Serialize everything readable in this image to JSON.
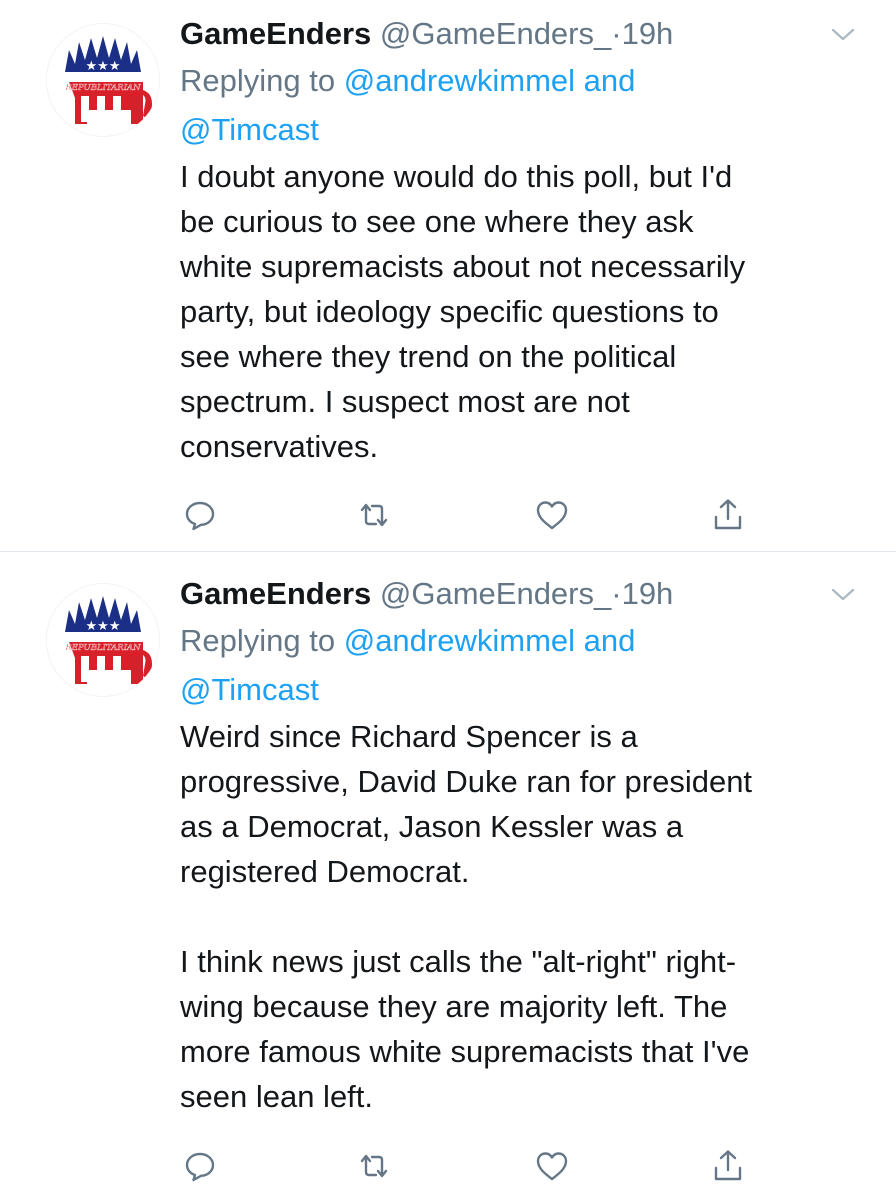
{
  "tweets": [
    {
      "display_name": "GameEnders",
      "handle": "@GameEnders_",
      "separator": "·",
      "time": "19h",
      "reply_prefix": "Replying to",
      "reply_user1": "@andrewkimmel",
      "reply_and": "and",
      "reply_user2": "@Timcast",
      "avatar_text": "REPUBLITARIAN",
      "body": "I doubt anyone would do this poll, but I'd\nbe curious to see one where they ask\nwhite supremacists about not necessarily\nparty, but ideology specific questions to\nsee where they trend on the political\nspectrum. I suspect most are not\nconservatives."
    },
    {
      "display_name": "GameEnders",
      "handle": "@GameEnders_",
      "separator": "·",
      "time": "19h",
      "reply_prefix": "Replying to",
      "reply_user1": "@andrewkimmel",
      "reply_and": "and",
      "reply_user2": "@Timcast",
      "avatar_text": "REPUBLITARIAN",
      "body": "Weird since Richard Spencer is a\nprogressive, David Duke ran for president\nas a Democrat, Jason Kessler was a\nregistered Democrat.\n\nI think news just calls the \"alt-right\" right-\nwing because they are majority left. The\nmore famous white supremacists that I've\nseen lean left."
    }
  ],
  "icons": [
    "reply-icon",
    "retweet-icon",
    "like-icon",
    "share-icon",
    "chevron-down-icon"
  ],
  "colors": {
    "link": "#1da1f2",
    "muted": "#657786",
    "text": "#14171a",
    "divider": "#e1e8ed",
    "avatar_red": "#d6202a",
    "avatar_blue": "#1c2f86"
  }
}
